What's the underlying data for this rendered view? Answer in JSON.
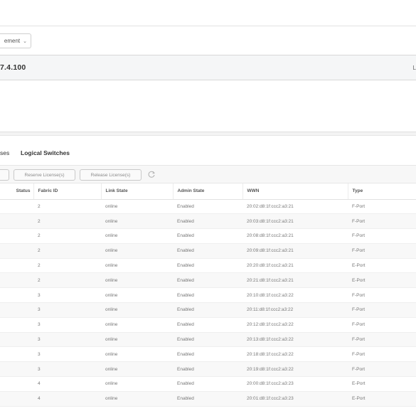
{
  "management": {
    "label": "ement",
    "chevron": "⌄"
  },
  "device": {
    "ip": "7.4.100",
    "corner_text": "L"
  },
  "tabs": [
    {
      "label": "ses"
    },
    {
      "label": "Logical Switches"
    }
  ],
  "toolbar": {
    "buttons": [
      {
        "label": ""
      },
      {
        "label": "Reserve License(s)"
      },
      {
        "label": "Release License(s)"
      }
    ],
    "refresh_icon": "refresh-icon"
  },
  "table": {
    "columns": [
      "Status",
      "Fabric ID",
      "Link State",
      "Admin State",
      "WWN",
      "Type"
    ],
    "rows": [
      [
        "",
        "2",
        "online",
        "Enabled",
        "20:02:d8:1f:ccc2:a3:21",
        "F-Port"
      ],
      [
        "",
        "2",
        "online",
        "Enabled",
        "20:03:d8:1f:ccc2:a3:21",
        "F-Port"
      ],
      [
        "",
        "2",
        "online",
        "Enabled",
        "20:08:d8:1f:ccc2:a3:21",
        "F-Port"
      ],
      [
        "",
        "2",
        "online",
        "Enabled",
        "20:09:d8:1f:ccc2:a3:21",
        "F-Port"
      ],
      [
        "",
        "2",
        "online",
        "Enabled",
        "20:20:d8:1f:ccc2:a3:21",
        "E-Port"
      ],
      [
        "",
        "2",
        "online",
        "Enabled",
        "20:21:d8:1f:ccc2:a3:21",
        "E-Port"
      ],
      [
        "",
        "3",
        "online",
        "Enabled",
        "20:10:d8:1f:ccc2:a3:22",
        "F-Port"
      ],
      [
        "",
        "3",
        "online",
        "Enabled",
        "20:11:d8:1f:ccc2:a3:22",
        "F-Port"
      ],
      [
        "",
        "3",
        "online",
        "Enabled",
        "20:12:d8:1f:ccc2:a3:22",
        "F-Port"
      ],
      [
        "",
        "3",
        "online",
        "Enabled",
        "20:13:d8:1f:ccc2:a3:22",
        "F-Port"
      ],
      [
        "",
        "3",
        "online",
        "Enabled",
        "20:18:d8:1f:ccc2:a3:22",
        "F-Port"
      ],
      [
        "",
        "3",
        "online",
        "Enabled",
        "20:19:d8:1f:ccc2:a3:22",
        "F-Port"
      ],
      [
        "",
        "4",
        "online",
        "Enabled",
        "20:00:d8:1f:ccc2:a3:23",
        "E-Port"
      ],
      [
        "",
        "4",
        "online",
        "Enabled",
        "20:01:d8:1f:ccc2:a3:23",
        "E-Port"
      ]
    ]
  }
}
